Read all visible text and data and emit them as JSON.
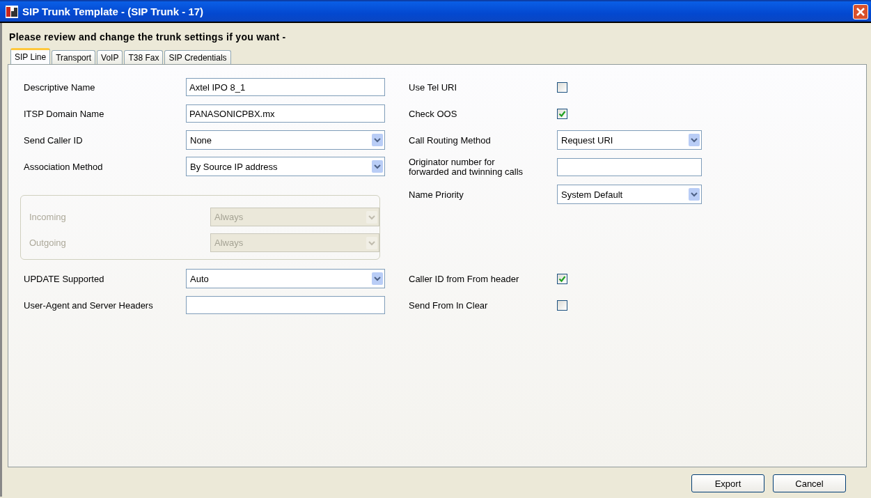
{
  "window": {
    "title": "SIP Trunk Template - (SIP Trunk - 17)"
  },
  "heading": "Please review and change the trunk settings if you want  -",
  "tabs": [
    {
      "label": "SIP Line",
      "selected": true
    },
    {
      "label": "Transport",
      "selected": false
    },
    {
      "label": "VoIP",
      "selected": false
    },
    {
      "label": "T38 Fax",
      "selected": false
    },
    {
      "label": "SIP Credentials",
      "selected": false
    }
  ],
  "upper": {
    "left": [
      {
        "kind": "text",
        "label": "Descriptive Name",
        "value": "Axtel IPO 8_1"
      },
      {
        "kind": "text",
        "label": "ITSP Domain Name",
        "value": "PANASONICPBX.mx"
      },
      {
        "kind": "select",
        "label": "Send Caller ID",
        "value": "None",
        "disabled": false
      },
      {
        "kind": "select",
        "label": "Association Method",
        "value": "By Source IP address",
        "disabled": false
      }
    ],
    "right": [
      {
        "kind": "checkbox",
        "label": "Use Tel URI",
        "checked": false
      },
      {
        "kind": "checkbox",
        "label": "Check OOS",
        "checked": true
      },
      {
        "kind": "select",
        "label": "Call Routing Method",
        "value": "Request URI",
        "disabled": false
      },
      {
        "kind": "text",
        "label": "Originator number for forwarded and twinning calls"
      },
      {
        "kind": "select",
        "label": "Name Priority",
        "value": "System Default",
        "disabled": false
      }
    ]
  },
  "options_group": [
    {
      "label": "Incoming",
      "value": "Always",
      "disabled": true
    },
    {
      "label": "Outgoing",
      "value": "Always",
      "disabled": true
    }
  ],
  "lower": {
    "left": [
      {
        "kind": "select",
        "label": "UPDATE Supported",
        "value": "Auto",
        "disabled": false
      },
      {
        "kind": "text",
        "label": "User-Agent and Server Headers"
      }
    ],
    "right": [
      {
        "kind": "checkbox",
        "label": "Caller ID from From header",
        "checked": true
      },
      {
        "kind": "checkbox",
        "label": "Send From In Clear",
        "checked": false
      }
    ]
  },
  "buttons": [
    "Export",
    "Cancel"
  ]
}
